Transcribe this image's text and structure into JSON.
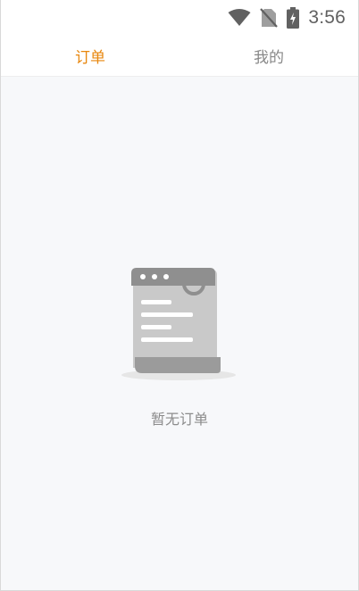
{
  "status_bar": {
    "time": "3:56",
    "icons": [
      "wifi-icon",
      "no-sim-icon",
      "battery-charging-icon"
    ]
  },
  "tabs": [
    {
      "label": "订单",
      "active": true
    },
    {
      "label": "我的",
      "active": false
    }
  ],
  "empty_state": {
    "icon": "empty-orders-icon",
    "message": "暂无订单"
  },
  "colors": {
    "accent": "#e8870e",
    "tab_inactive": "#888888",
    "background": "#f7f8fa"
  }
}
